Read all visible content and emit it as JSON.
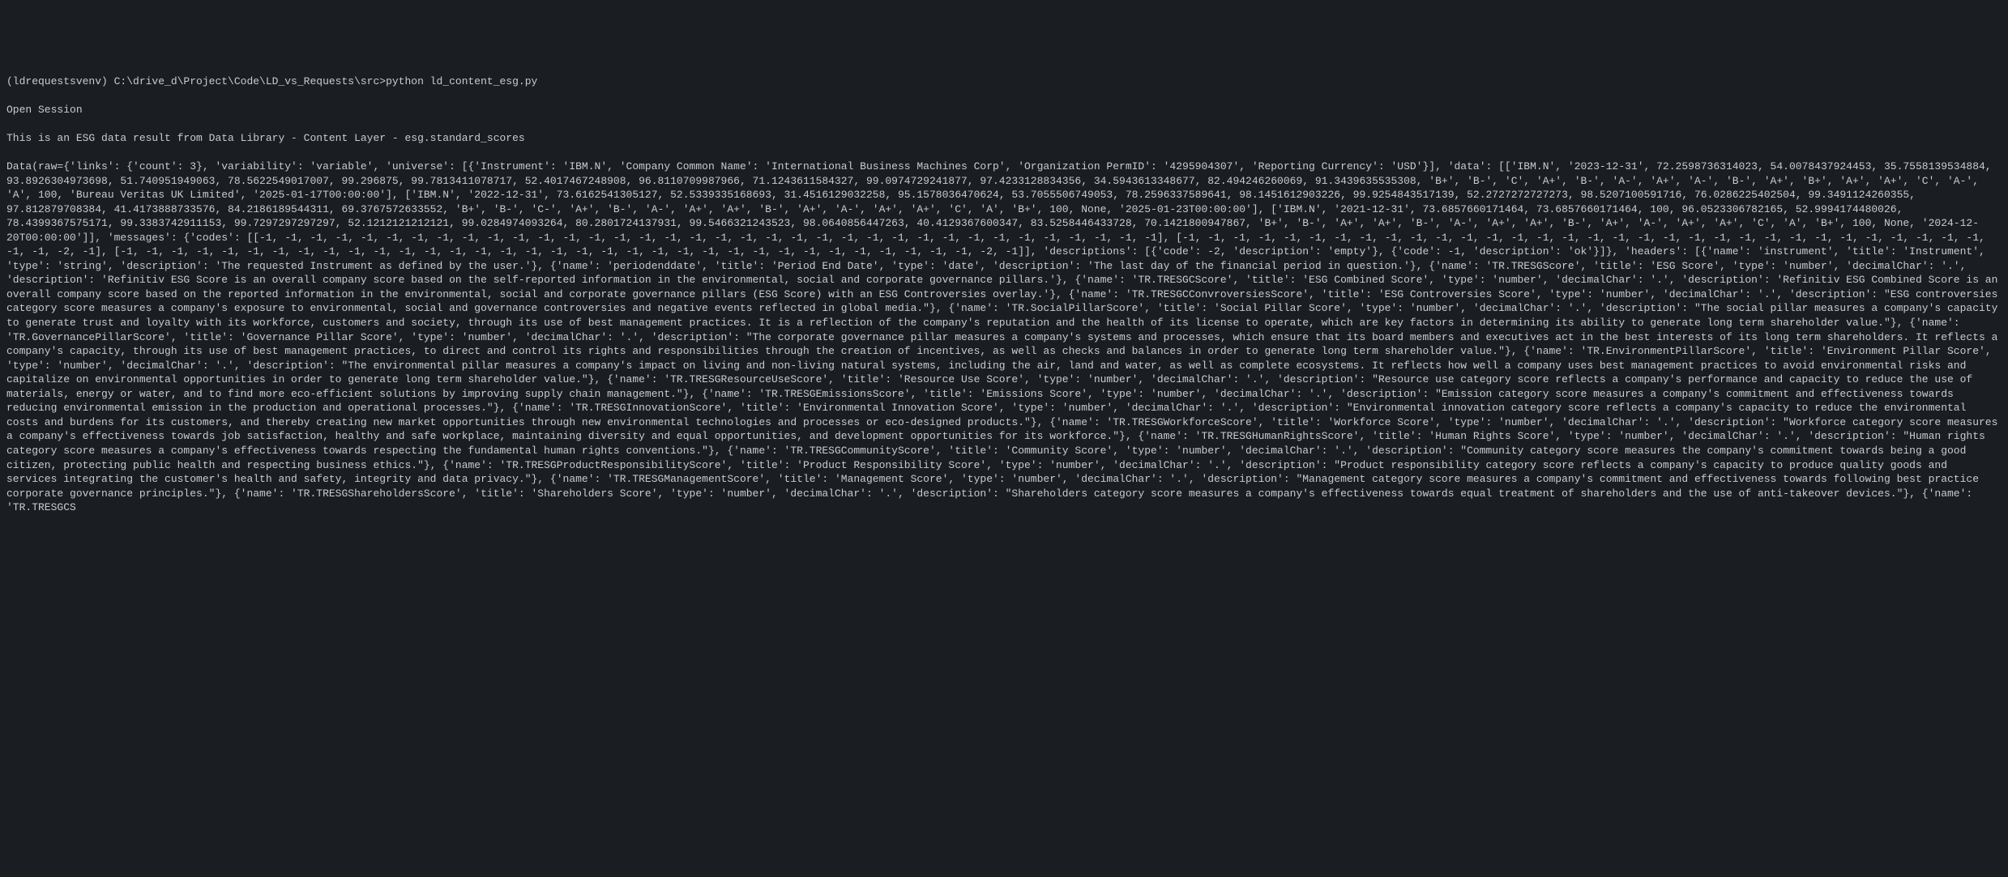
{
  "terminal": {
    "prompt_line": "(ldrequestsvenv) C:\\drive_d\\Project\\Code\\LD_vs_Requests\\src>python ld_content_esg.py",
    "line2": "Open Session",
    "line3": "This is an ESG data result from Data Library - Content Layer - esg.standard_scores",
    "data_output": "Data(raw={'links': {'count': 3}, 'variability': 'variable', 'universe': [{'Instrument': 'IBM.N', 'Company Common Name': 'International Business Machines Corp', 'Organization PermID': '4295904307', 'Reporting Currency': 'USD'}], 'data': [['IBM.N', '2023-12-31', 72.2598736314023, 54.0078437924453, 35.7558139534884, 93.8926304973698, 51.740951949063, 78.5622549017007, 99.296875, 99.7813411078717, 52.4017467248908, 96.8110709987966, 71.1243611584327, 99.0974729241877, 97.4233128834356, 34.5943613348677, 82.494246260069, 91.3439635535308, 'B+', 'B-', 'C', 'A+', 'B-', 'A-', 'A+', 'A-', 'B-', 'A+', 'B+', 'A+', 'A+', 'C', 'A-', 'A', 100, 'Bureau Veritas UK Limited', '2025-01-17T00:00:00'], ['IBM.N', '2022-12-31', 73.6162541305127, 52.5339335168693, 31.4516129032258, 95.1578036470624, 53.7055506749053, 78.2596337589641, 98.1451612903226, 99.9254843517139, 52.2727272727273, 98.5207100591716, 76.0286225402504, 99.3491124260355, 97.812879708384, 41.4173888733576, 84.2186189544311, 69.3767572633552, 'B+', 'B-', 'C-', 'A+', 'B-', 'A-', 'A+', 'A+', 'B-', 'A+', 'A-', 'A+', 'A+', 'C', 'A', 'B+', 100, None, '2025-01-23T00:00:00'], ['IBM.N', '2021-12-31', 73.6857660171464, 73.6857660171464, 100, 96.0523306782165, 52.9994174480026, 78.4399367575171, 99.3383742911153, 99.7297297297297, 52.1212121212121, 99.0284974093264, 80.2801724137931, 99.5466321243523, 98.0640856447263, 40.4129367600347, 83.5258446433728, 70.1421800947867, 'B+', 'B-', 'A+', 'A+', 'B-', 'A-', 'A+', 'A+', 'B-', 'A+', 'A-', 'A+', 'A+', 'C', 'A', 'B+', 100, None, '2024-12-20T00:00:00']], 'messages': {'codes': [[-1, -1, -1, -1, -1, -1, -1, -1, -1, -1, -1, -1, -1, -1, -1, -1, -1, -1, -1, -1, -1, -1, -1, -1, -1, -1, -1, -1, -1, -1, -1, -1, -1, -1, -1, -1], [-1, -1, -1, -1, -1, -1, -1, -1, -1, -1, -1, -1, -1, -1, -1, -1, -1, -1, -1, -1, -1, -1, -1, -1, -1, -1, -1, -1, -1, -1, -1, -1, -1, -1, -2, -1], [-1, -1, -1, -1, -1, -1, -1, -1, -1, -1, -1, -1, -1, -1, -1, -1, -1, -1, -1, -1, -1, -1, -1, -1, -1, -1, -1, -1, -1, -1, -1, -1, -1, -1, -2, -1]], 'descriptions': [{'code': -2, 'description': 'empty'}, {'code': -1, 'description': 'ok'}]}, 'headers': [{'name': 'instrument', 'title': 'Instrument', 'type': 'string', 'description': 'The requested Instrument as defined by the user.'}, {'name': 'periodenddate', 'title': 'Period End Date', 'type': 'date', 'description': 'The last day of the financial period in question.'}, {'name': 'TR.TRESGScore', 'title': 'ESG Score', 'type': 'number', 'decimalChar': '.', 'description': 'Refinitiv ESG Score is an overall company score based on the self-reported information in the environmental, social and corporate governance pillars.'}, {'name': 'TR.TRESGCScore', 'title': 'ESG Combined Score', 'type': 'number', 'decimalChar': '.', 'description': 'Refinitiv ESG Combined Score is an overall company score based on the reported information in the environmental, social and corporate governance pillars (ESG Score) with an ESG Controversies overlay.'}, {'name': 'TR.TRESGCConvroversiesScore', 'title': 'ESG Controversies Score', 'type': 'number', 'decimalChar': '.', 'description': \"ESG controversies category score measures a company's exposure to environmental, social and governance controversies and negative events reflected in global media.\"}, {'name': 'TR.SocialPillarScore', 'title': 'Social Pillar Score', 'type': 'number', 'decimalChar': '.', 'description': \"The social pillar measures a company's capacity to generate trust and loyalty with its workforce, customers and society, through its use of best management practices. It is a reflection of the company's reputation and the health of its license to operate, which are key factors in determining its ability to generate long term shareholder value.\"}, {'name': 'TR.GovernancePillarScore', 'title': 'Governance Pillar Score', 'type': 'number', 'decimalChar': '.', 'description': \"The corporate governance pillar measures a company's systems and processes, which ensure that its board members and executives act in the best interests of its long term shareholders. It reflects a company's capacity, through its use of best management practices, to direct and control its rights and responsibilities through the creation of incentives, as well as checks and balances in order to generate long term shareholder value.\"}, {'name': 'TR.EnvironmentPillarScore', 'title': 'Environment Pillar Score', 'type': 'number', 'decimalChar': '.', 'description': \"The environmental pillar measures a company's impact on living and non-living natural systems, including the air, land and water, as well as complete ecosystems. It reflects how well a company uses best management practices to avoid environmental risks and capitalize on environmental opportunities in order to generate long term shareholder value.\"}, {'name': 'TR.TRESGResourceUseScore', 'title': 'Resource Use Score', 'type': 'number', 'decimalChar': '.', 'description': \"Resource use category score reflects a company's performance and capacity to reduce the use of materials, energy or water, and to find more eco-efficient solutions by improving supply chain management.\"}, {'name': 'TR.TRESGEmissionsScore', 'title': 'Emissions Score', 'type': 'number', 'decimalChar': '.', 'description': \"Emission category score measures a company's commitment and effectiveness towards reducing environmental emission in the production and operational processes.\"}, {'name': 'TR.TRESGInnovationScore', 'title': 'Environmental Innovation Score', 'type': 'number', 'decimalChar': '.', 'description': \"Environmental innovation category score reflects a company's capacity to reduce the environmental costs and burdens for its customers, and thereby creating new market opportunities through new environmental technologies and processes or eco-designed products.\"}, {'name': 'TR.TRESGWorkforceScore', 'title': 'Workforce Score', 'type': 'number', 'decimalChar': '.', 'description': \"Workforce category score measures a company's effectiveness towards job satisfaction, healthy and safe workplace, maintaining diversity and equal opportunities, and development opportunities for its workforce.\"}, {'name': 'TR.TRESGHumanRightsScore', 'title': 'Human Rights Score', 'type': 'number', 'decimalChar': '.', 'description': \"Human rights category score measures a company's effectiveness towards respecting the fundamental human rights conventions.\"}, {'name': 'TR.TRESGCommunityScore', 'title': 'Community Score', 'type': 'number', 'decimalChar': '.', 'description': \"Community category score measures the company's commitment towards being a good citizen, protecting public health and respecting business ethics.\"}, {'name': 'TR.TRESGProductResponsibilityScore', 'title': 'Product Responsibility Score', 'type': 'number', 'decimalChar': '.', 'description': \"Product responsibility category score reflects a company's capacity to produce quality goods and services integrating the customer's health and safety, integrity and data privacy.\"}, {'name': 'TR.TRESGManagementScore', 'title': 'Management Score', 'type': 'number', 'decimalChar': '.', 'description': \"Management category score measures a company's commitment and effectiveness towards following best practice corporate governance principles.\"}, {'name': 'TR.TRESGShareholdersScore', 'title': 'Shareholders Score', 'type': 'number', 'decimalChar': '.', 'description': \"Shareholders category score measures a company's effectiveness towards equal treatment of shareholders and the use of anti-takeover devices.\"}, {'name': 'TR.TRESGCS"
  }
}
